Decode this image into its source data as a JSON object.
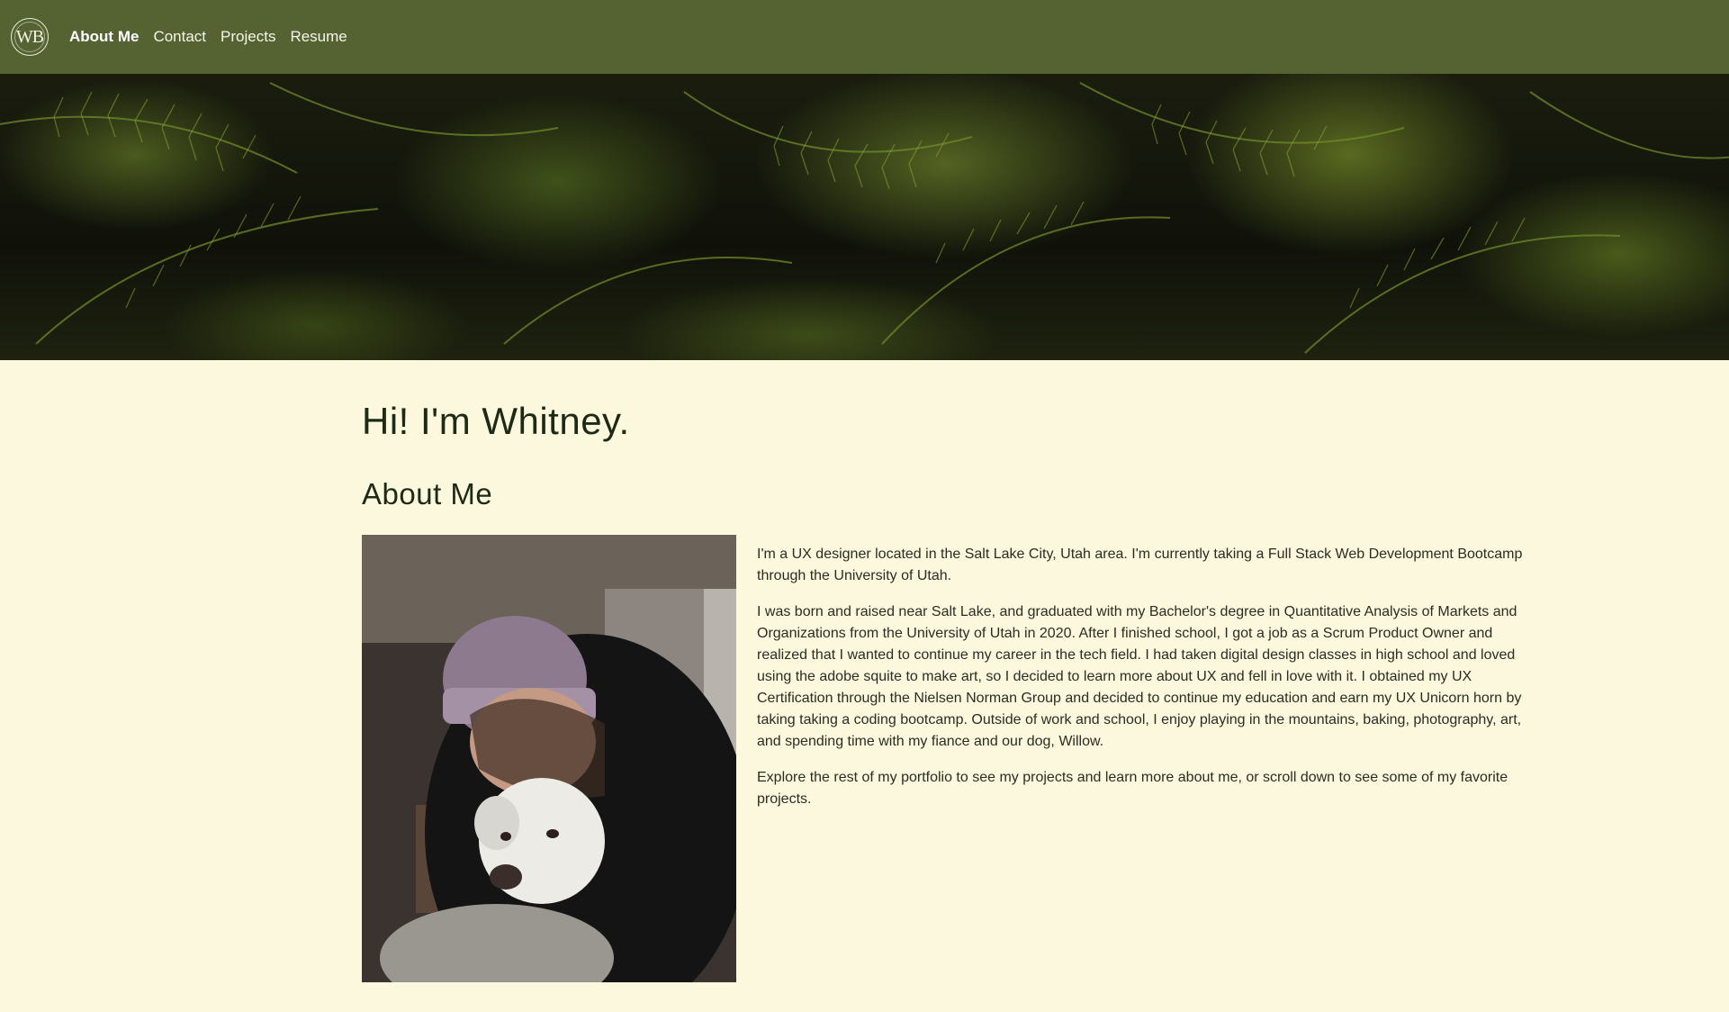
{
  "logo": {
    "text": "WB"
  },
  "nav": {
    "items": [
      {
        "label": "About Me",
        "active": true
      },
      {
        "label": "Contact",
        "active": false
      },
      {
        "label": "Projects",
        "active": false
      },
      {
        "label": "Resume",
        "active": false
      }
    ]
  },
  "hero": {
    "image": "fern-leaves-banner"
  },
  "main": {
    "greeting": "Hi! I'm Whitney.",
    "section_title": "About Me",
    "photo": "portrait-with-dog",
    "paragraphs": [
      "I'm a UX designer located in the Salt Lake City, Utah area. I'm currently taking a Full Stack Web Development Bootcamp through the University of Utah.",
      "I was born and raised near Salt Lake, and graduated with my Bachelor's degree in Quantitative Analysis of Markets and Organizations from the University of Utah in 2020. After I finished school, I got a job as a Scrum Product Owner and realized that I wanted to continue my career in the tech field. I had taken digital design classes in high school and loved using the adobe squite to make art, so I decided to learn more about UX and fell in love with it. I obtained my UX Certification through the Nielsen Norman Group and decided to continue my education and earn my UX Unicorn horn by taking taking a coding bootcamp. Outside of work and school, I enjoy playing in the mountains, baking, photography, art, and spending time with my fiance and our dog, Willow.",
      "Explore the rest of my portfolio to see my projects and learn more about me, or scroll down to see some of my favorite projects."
    ]
  },
  "colors": {
    "navbar": "#556332",
    "background": "#fcf8de",
    "heading": "#1f2a16",
    "body_text": "#2b2d22"
  }
}
